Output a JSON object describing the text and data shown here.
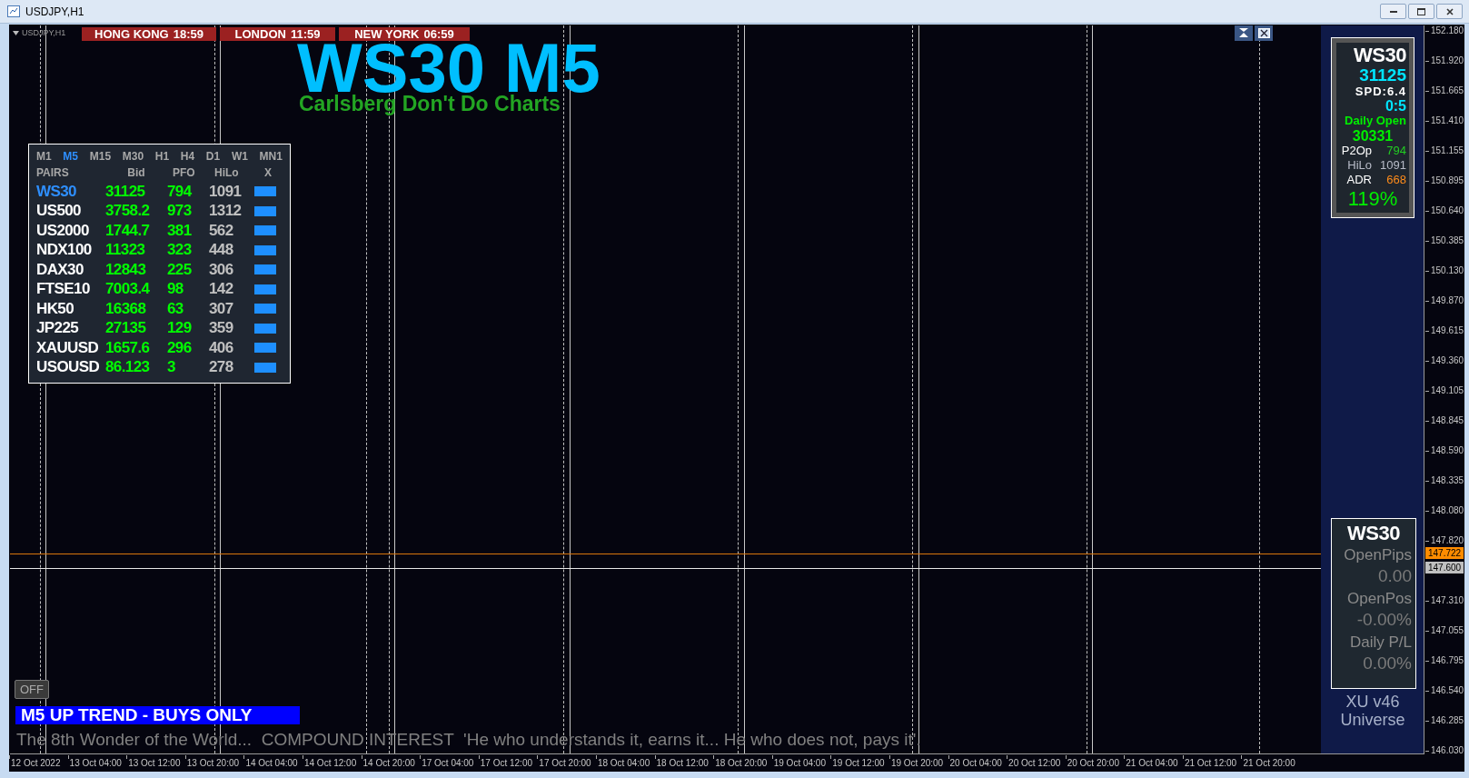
{
  "window": {
    "title": "USDJPY,H1"
  },
  "chart": {
    "symbol_label": "USDJPY,H1",
    "clocks": [
      {
        "city": "HONG KONG",
        "time": "18:59"
      },
      {
        "city": "LONDON",
        "time": "11:59"
      },
      {
        "city": "NEW YORK",
        "time": "06:59"
      }
    ],
    "title": "WS30 M5",
    "subtitle": "Carlsberg Don't Do Charts",
    "price_axis": [
      "152.180",
      "151.920",
      "151.665",
      "151.410",
      "151.155",
      "150.895",
      "150.640",
      "150.385",
      "150.130",
      "149.870",
      "149.615",
      "149.360",
      "149.105",
      "148.845",
      "148.590",
      "148.335",
      "148.080",
      "147.820",
      "147.310",
      "147.055",
      "146.795",
      "146.540",
      "146.285",
      "146.030"
    ],
    "price_tags": [
      {
        "text": "147.722",
        "color": "#ff8c00"
      },
      {
        "text": "147.600",
        "color": "#c0c0c0"
      }
    ],
    "time_axis": [
      "12 Oct 2022",
      "13 Oct 04:00",
      "13 Oct 12:00",
      "13 Oct 20:00",
      "14 Oct 04:00",
      "14 Oct 12:00",
      "14 Oct 20:00",
      "17 Oct 04:00",
      "17 Oct 12:00",
      "17 Oct 20:00",
      "18 Oct 04:00",
      "18 Oct 12:00",
      "18 Oct 20:00",
      "19 Oct 04:00",
      "19 Oct 12:00",
      "19 Oct 20:00",
      "20 Oct 04:00",
      "20 Oct 12:00",
      "20 Oct 20:00",
      "21 Oct 04:00",
      "21 Oct 12:00",
      "21 Oct 20:00"
    ]
  },
  "market_watch": {
    "timeframes": [
      {
        "label": "M1",
        "selected": false
      },
      {
        "label": "M5",
        "selected": true
      },
      {
        "label": "M15",
        "selected": false
      },
      {
        "label": "M30",
        "selected": false
      },
      {
        "label": "H1",
        "selected": false
      },
      {
        "label": "H4",
        "selected": false
      },
      {
        "label": "D1",
        "selected": false
      },
      {
        "label": "W1",
        "selected": false
      },
      {
        "label": "MN1",
        "selected": false
      }
    ],
    "columns": [
      "PAIRS",
      "Bid",
      "PFO",
      "HiLo",
      "X"
    ],
    "rows": [
      {
        "pair": "WS30",
        "bid": "31125",
        "pfo": "794",
        "hilo": "1091",
        "selected": true
      },
      {
        "pair": "US500",
        "bid": "3758.2",
        "pfo": "973",
        "hilo": "1312",
        "selected": false
      },
      {
        "pair": "US2000",
        "bid": "1744.7",
        "pfo": "381",
        "hilo": "562",
        "selected": false
      },
      {
        "pair": "NDX100",
        "bid": "11323",
        "pfo": "323",
        "hilo": "448",
        "selected": false
      },
      {
        "pair": "DAX30",
        "bid": "12843",
        "pfo": "225",
        "hilo": "306",
        "selected": false
      },
      {
        "pair": "FTSE10",
        "bid": "7003.4",
        "pfo": "98",
        "hilo": "142",
        "selected": false
      },
      {
        "pair": "HK50",
        "bid": "16368",
        "pfo": "63",
        "hilo": "307",
        "selected": false
      },
      {
        "pair": "JP225",
        "bid": "27135",
        "pfo": "129",
        "hilo": "359",
        "selected": false
      },
      {
        "pair": "XAUUSD",
        "bid": "1657.6",
        "pfo": "296",
        "hilo": "406",
        "selected": false
      },
      {
        "pair": "USOUSD",
        "bid": "86.123",
        "pfo": "3",
        "hilo": "278",
        "selected": false
      }
    ]
  },
  "info_panel": {
    "symbol": "WS30",
    "price": "31125",
    "spread": "SPD:6.4",
    "countdown": "0:5",
    "daily_open_label": "Daily Open",
    "daily_open": "30331",
    "stats": [
      {
        "label": "P2Op",
        "value": "794",
        "color": "#22cc22"
      },
      {
        "label": "HiLo",
        "value": "1091",
        "color": "#b8bcc8"
      },
      {
        "label": "ADR",
        "value": "668",
        "color": "#ff8c1a"
      }
    ],
    "percent": "119%"
  },
  "pl_panel": {
    "symbol": "WS30",
    "items": [
      {
        "label": "OpenPips",
        "value": "0.00"
      },
      {
        "label": "OpenPos",
        "value": "-0.00%"
      },
      {
        "label": "Daily P/L",
        "value": "0.00%"
      }
    ]
  },
  "footer": {
    "version": "XU v46",
    "name": "Universe"
  },
  "toggle": {
    "label": "OFF"
  },
  "trend_banner": "M5 UP TREND - BUYS ONLY",
  "quote": "The 8th Wonder of the World...  COMPOUND INTEREST  'He who understands it, earns it... He who does not, pays it'."
}
